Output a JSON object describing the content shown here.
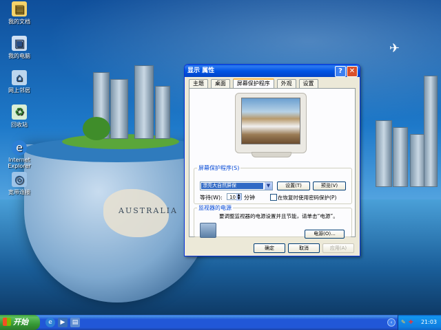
{
  "desktop": {
    "icons": [
      {
        "label": "我的文档",
        "icon": "folder-icon"
      },
      {
        "label": "我的电脑",
        "icon": "computer-icon"
      },
      {
        "label": "网上邻居",
        "icon": "network-icon"
      },
      {
        "label": "回收站",
        "icon": "recycle-bin-icon"
      },
      {
        "label": "Internet Explorer",
        "icon": "ie-icon"
      },
      {
        "label": "宽带连接",
        "icon": "broadband-icon"
      }
    ],
    "wallpaper_text": "AUSTRALIA"
  },
  "dialog": {
    "title": "显示 属性",
    "help_button": "?",
    "close_button": "✕",
    "tabs": [
      "主题",
      "桌面",
      "屏幕保护程序",
      "外观",
      "设置"
    ],
    "active_tab": "屏幕保护程序",
    "screensaver": {
      "group_label": "屏幕保护程序(S)",
      "selected": "漂亮大自然屏保",
      "settings_button": "设置(T)",
      "preview_button": "预览(V)",
      "wait_label": "等待(W):",
      "wait_value": "10",
      "wait_unit": "分钟",
      "password_checkbox_label": "在恢复时使用密码保护(P)",
      "password_checked": false
    },
    "power": {
      "group_label": "监视器的电源",
      "description": "要调整监视器的电源设置并且节能，请单击“电源”。",
      "power_button": "电源(O)..."
    },
    "footer": {
      "ok": "确定",
      "cancel": "取消",
      "apply": "应用(A)"
    }
  },
  "taskbar": {
    "start_label": "开始",
    "quick_launch": [
      "ie-icon",
      "media-player-icon",
      "show-desktop-icon"
    ],
    "clock": "21:03"
  }
}
